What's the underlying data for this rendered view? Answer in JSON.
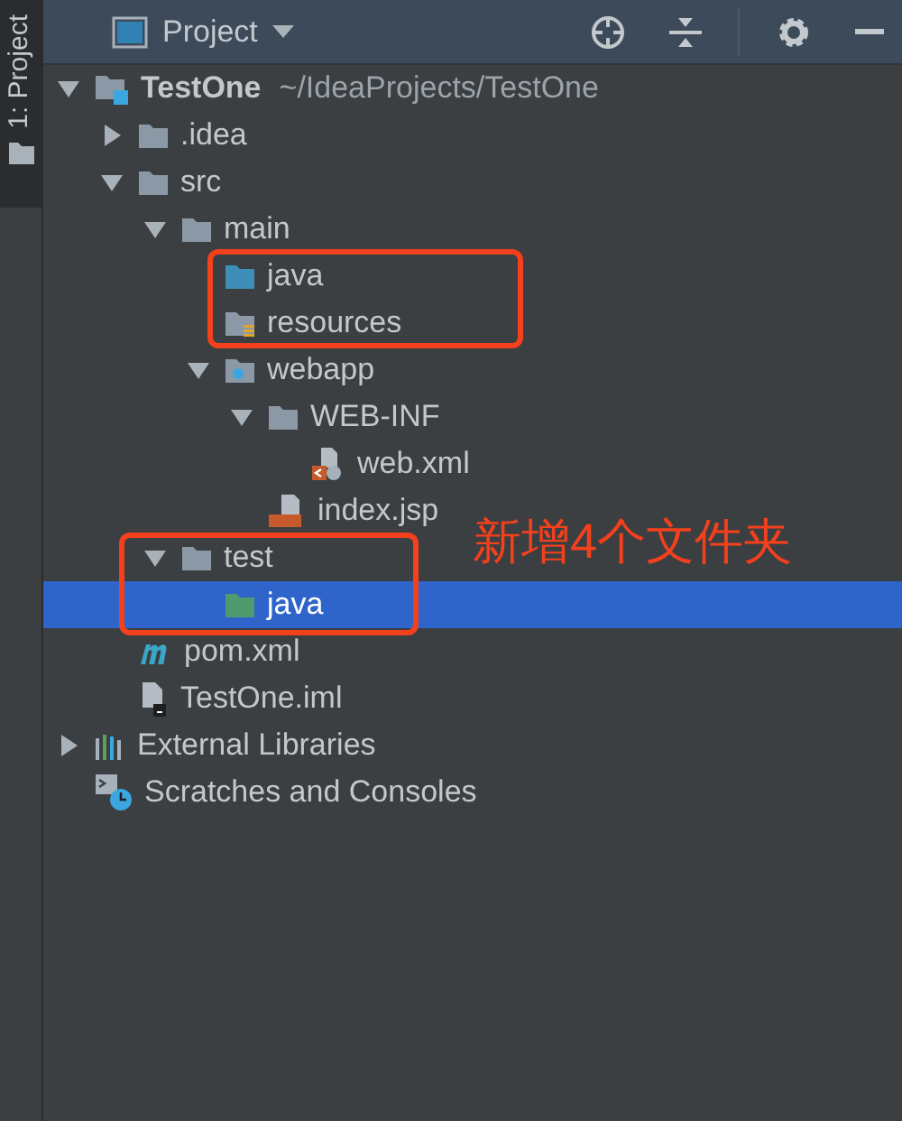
{
  "side_tab": {
    "label": "1: Project",
    "selected": true
  },
  "header": {
    "title": "Project"
  },
  "tree": [
    {
      "kind": "module",
      "label": "TestOne",
      "path": "~/IdeaProjects/TestOne",
      "expanded": true,
      "selected": false,
      "children": [
        {
          "kind": "folder",
          "label": ".idea",
          "expanded": false,
          "selected": false
        },
        {
          "kind": "folder",
          "label": "src",
          "expanded": true,
          "selected": false,
          "children": [
            {
              "kind": "folder",
              "label": "main",
              "expanded": true,
              "selected": false,
              "children": [
                {
                  "kind": "source-folder",
                  "label": "java",
                  "selected": false
                },
                {
                  "kind": "resources-folder",
                  "label": "resources",
                  "selected": false
                },
                {
                  "kind": "web-folder",
                  "label": "webapp",
                  "expanded": true,
                  "selected": false,
                  "children": [
                    {
                      "kind": "folder",
                      "label": "WEB-INF",
                      "expanded": true,
                      "selected": false,
                      "children": [
                        {
                          "kind": "xml",
                          "label": "web.xml",
                          "selected": false
                        }
                      ]
                    },
                    {
                      "kind": "jsp",
                      "label": "index.jsp",
                      "selected": false
                    }
                  ]
                }
              ]
            },
            {
              "kind": "folder",
              "label": "test",
              "expanded": true,
              "selected": false,
              "children": [
                {
                  "kind": "test-folder",
                  "label": "java",
                  "selected": true
                }
              ]
            }
          ]
        },
        {
          "kind": "maven",
          "label": "pom.xml",
          "selected": false
        },
        {
          "kind": "iml",
          "label": "TestOne.iml",
          "selected": false
        }
      ]
    },
    {
      "kind": "libraries",
      "label": "External Libraries",
      "expanded": false,
      "selected": false
    },
    {
      "kind": "scratches",
      "label": "Scratches and Consoles",
      "selected": false
    }
  ],
  "annotation": {
    "text": "新增4个文件夹"
  }
}
